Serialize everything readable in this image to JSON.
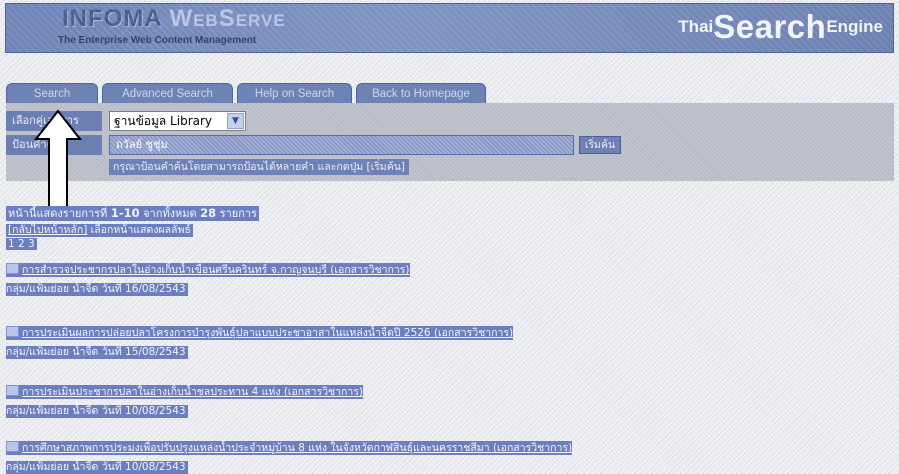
{
  "header": {
    "brand_part1": "INFOMA",
    "brand_part2": "WebServe",
    "tagline": "The Enterprise Web Content Management",
    "logo_thai": "Thai",
    "logo_search": "Search",
    "logo_engine": "Engine"
  },
  "tabs": [
    {
      "label": "Search"
    },
    {
      "label": "Advanced Search"
    },
    {
      "label": "Help on Search"
    },
    {
      "label": "Back to Homepage"
    }
  ],
  "form": {
    "select_label": "เลือกคู่เอกสาร",
    "select_value": "ฐานข้อมูล Library",
    "query_label": "ป้อนคำค้น",
    "query_value": "ถวัลย์ ชูชุ่ม",
    "search_button": "เริ่มค้น",
    "hint": "กรุณาป้อนคำค้นโดยสามารถป้อนได้หลายคำ และกดปุ่ม [เริ่มค้น]"
  },
  "results_info": {
    "summary_prefix": "หน้านี้แสดงรายการที่",
    "summary_range": "1-10",
    "summary_middle": "จากทั้งหมด",
    "summary_total": "28",
    "summary_suffix": "รายการ",
    "back_link": "[กลับไปหน้าหลัก]",
    "choose_page": "เลือกหน้าแสดงผลลัพธ์",
    "pages": "1 2 3"
  },
  "results": [
    {
      "title": "การสำรวจประชากรปลาในอ่างเก็บน้ำเขื่อนศรีนครินทร์ จ.กาญจนบุรี (เอกสารวิชาการ)",
      "meta": "กลุ่ม/แฟ้มย่อย น้ำจืด วันที่ 16/08/2543"
    },
    {
      "title": "การประเมินผลการปล่อยปลาโครงการบำรุงพันธุ์ปลาแบบประชาอาสาในแหล่งน้ำจืดปี 2526 (เอกสารวิชาการ)",
      "meta": "กลุ่ม/แฟ้มย่อย น้ำจืด วันที่ 15/08/2543"
    },
    {
      "title": "การประเมินประชากรปลาในอ่างเก็บน้ำชลประทาน 4 แห่ง (เอกสารวิชาการ)",
      "meta": "กลุ่ม/แฟ้มย่อย น้ำจืด วันที่ 10/08/2543"
    },
    {
      "title": "การศึกษาสภาพการประมงเพื่อปรับปรุงแหล่งน้ำประจำหมู่บ้าน 8 แห่ง ในจังหวัดกาฬสินธุ์และนครราชสีมา (เอกสารวิชาการ)",
      "meta": "กลุ่ม/แฟ้มย่อย น้ำจืด วันที่ 10/08/2543"
    }
  ]
}
